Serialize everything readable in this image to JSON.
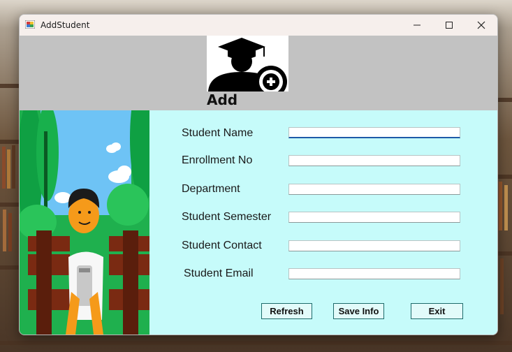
{
  "window": {
    "title": "AddStudent",
    "controls": {
      "minimize": "—",
      "maximize": "☐",
      "close": "✕"
    }
  },
  "header": {
    "heading": "Add Student",
    "icon": "student-add-icon",
    "background": "#c2c2c2"
  },
  "form": {
    "background": "#c6fbfa",
    "fields": [
      {
        "label": "Student Name",
        "value": "",
        "focused": true
      },
      {
        "label": "Enrollment No",
        "value": ""
      },
      {
        "label": "Department",
        "value": ""
      },
      {
        "label": "Student Semester",
        "value": ""
      },
      {
        "label": "Student Contact",
        "value": ""
      },
      {
        "label": "Student Email",
        "value": ""
      }
    ],
    "buttons": {
      "refresh": "Refresh",
      "save": "Save Info",
      "exit": "Exit"
    }
  },
  "illustration": "student-on-bench-illustration"
}
